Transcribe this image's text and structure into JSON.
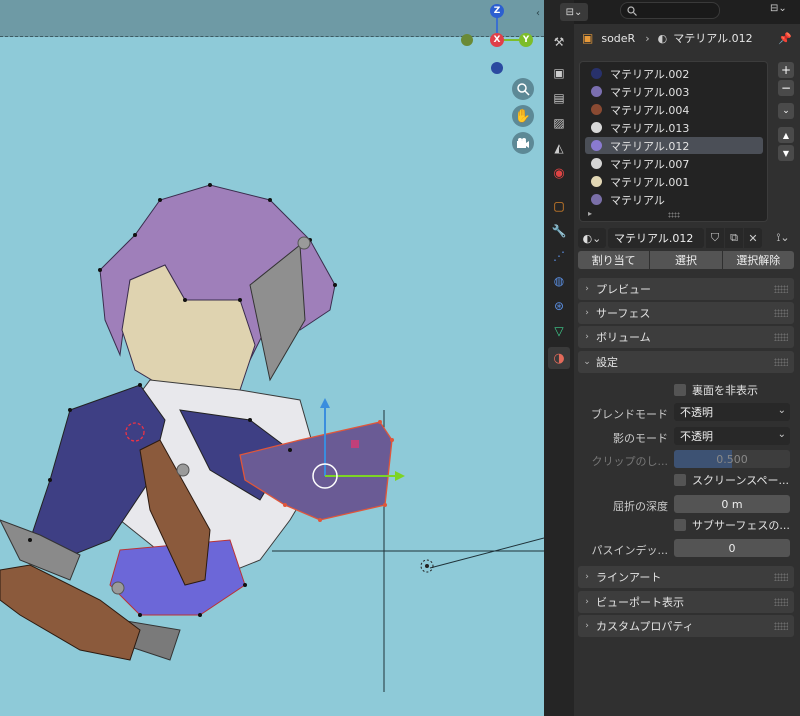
{
  "viewport": {
    "gizmo": {
      "z": "Z",
      "x": "X",
      "y": "Y"
    }
  },
  "header": {
    "object_name": "sodeR",
    "material_name": "マテリアル.012"
  },
  "material_slots": [
    {
      "label": "マテリアル.002",
      "color": "#28316b"
    },
    {
      "label": "マテリアル.003",
      "color": "#7b6fb0"
    },
    {
      "label": "マテリアル.004",
      "color": "#8a4a32"
    },
    {
      "label": "マテリアル.013",
      "color": "#d8d8d8"
    },
    {
      "label": "マテリアル.012",
      "color": "#8a7ad0",
      "selected": true
    },
    {
      "label": "マテリアル.007",
      "color": "#d4d4d4"
    },
    {
      "label": "マテリアル.001",
      "color": "#e2d7b5"
    },
    {
      "label": "マテリアル",
      "color": "#7a6fa8"
    }
  ],
  "material_field": {
    "value": "マテリアル.012"
  },
  "slot_buttons": {
    "assign": "割り当て",
    "select": "選択",
    "deselect": "選択解除"
  },
  "panels": {
    "preview": "プレビュー",
    "surface": "サーフェス",
    "volume": "ボリューム",
    "settings": "設定",
    "lineart": "ラインアート",
    "viewport_display": "ビューポート表示",
    "custom_props": "カスタムプロパティ"
  },
  "settings": {
    "backface_culling": "裏面を非表示",
    "blend_mode_label": "ブレンドモード",
    "blend_mode_value": "不透明",
    "shadow_mode_label": "影のモード",
    "shadow_mode_value": "不透明",
    "clip_label": "クリップのし...",
    "clip_value": "0.500",
    "screen_space": "スクリーンスペー...",
    "refraction_depth_label": "屈折の深度",
    "refraction_depth_value": "0 m",
    "subsurface": "サブサーフェスの...",
    "pass_index_label": "パスインデッ...",
    "pass_index_value": "0"
  },
  "colors": {
    "accent": "#4772b3",
    "viewport_bg": "#8ecad8",
    "panel_bg": "#303030"
  }
}
